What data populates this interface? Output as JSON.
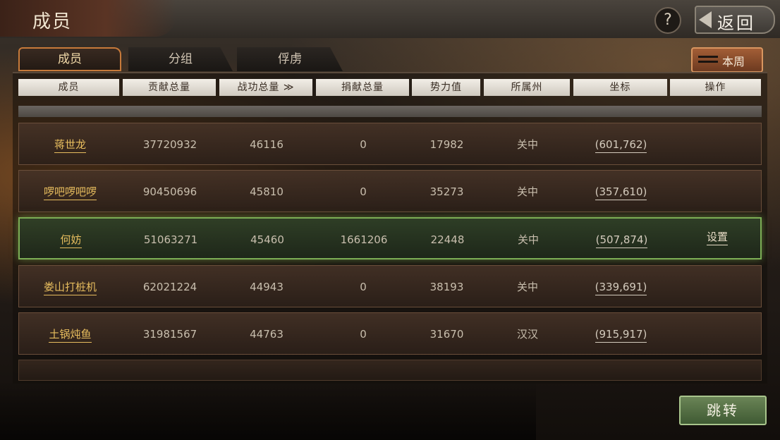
{
  "header": {
    "title": "成员",
    "help_label": "?",
    "back_label": "返回"
  },
  "tabs": [
    {
      "label": "成员",
      "active": true
    },
    {
      "label": "分组",
      "active": false
    },
    {
      "label": "俘虏",
      "active": false
    }
  ],
  "week_button": {
    "label": "本周"
  },
  "columns": [
    "成员",
    "贡献总量",
    "战功总量 ≫",
    "捐献总量",
    "势力值",
    "所属州",
    "坐标",
    "操作"
  ],
  "rows": [
    {
      "name": "蒋世龙",
      "contribution": "37720932",
      "merit": "46116",
      "donation": "0",
      "power": "17982",
      "state": "关中",
      "coord": "(601,762)",
      "op": ""
    },
    {
      "name": "啰吧啰吧啰",
      "contribution": "90450696",
      "merit": "45810",
      "donation": "0",
      "power": "35273",
      "state": "关中",
      "coord": "(357,610)",
      "op": ""
    },
    {
      "name": "何妨",
      "contribution": "51063271",
      "merit": "45460",
      "donation": "1661206",
      "power": "22448",
      "state": "关中",
      "coord": "(507,874)",
      "op": "设置"
    },
    {
      "name": "娄山打桩机",
      "contribution": "62021224",
      "merit": "44943",
      "donation": "0",
      "power": "38193",
      "state": "关中",
      "coord": "(339,691)",
      "op": ""
    },
    {
      "name": "土锅炖鱼",
      "contribution": "31981567",
      "merit": "44763",
      "donation": "0",
      "power": "31670",
      "state": "汉汉",
      "coord": "(915,917)",
      "op": ""
    }
  ],
  "jump_button": {
    "label": "跳转"
  },
  "colors": {
    "accent_gold": "#e7bd5e",
    "selected_border": "#7cae55",
    "active_tab_border": "#c77a3a"
  }
}
